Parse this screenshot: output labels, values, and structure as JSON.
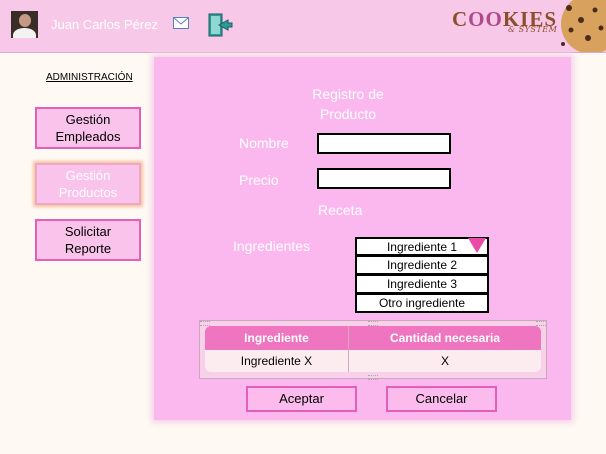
{
  "header": {
    "user_name": "Juan Carlos Pérez",
    "logo_title_part1": "C",
    "logo_title_part2": "OO",
    "logo_title_part3": "KIES",
    "logo_subtitle": "& SYSTEM",
    "avatar_icon": "avatar",
    "mail_icon": "mail-icon",
    "exit_icon": "exit-door-icon"
  },
  "sidebar": {
    "section_title": "ADMINISTRACIÓN",
    "items": [
      {
        "label_line1": "Gestión",
        "label_line2": "Empleados"
      },
      {
        "label_line1": "Gestión",
        "label_line2": "Productos",
        "active": true
      },
      {
        "label_line1": "Solicitar",
        "label_line2": "Reporte"
      }
    ]
  },
  "form": {
    "title_line1": "Registro de",
    "title_line2": "Producto",
    "name_label": "Nombre",
    "name_value": "",
    "price_label": "Precio",
    "price_value": "",
    "recipe_label": "Receta",
    "ingredients_label": "Ingredientes",
    "ingredient_options": [
      "Ingrediente 1",
      "Ingrediente 2",
      "Ingrediente 3",
      "Otro ingrediente"
    ]
  },
  "table": {
    "headers": [
      "Ingrediente",
      "Cantidad necesaria"
    ],
    "rows": [
      [
        "Ingrediente X",
        "X"
      ]
    ]
  },
  "actions": {
    "accept_label": "Aceptar",
    "cancel_label": "Cancelar"
  },
  "colors": {
    "header_bg": "#f8c8e8",
    "panel_bg": "#fbb8ef",
    "accent": "#e35fb8",
    "table_header": "#ef75c0"
  }
}
